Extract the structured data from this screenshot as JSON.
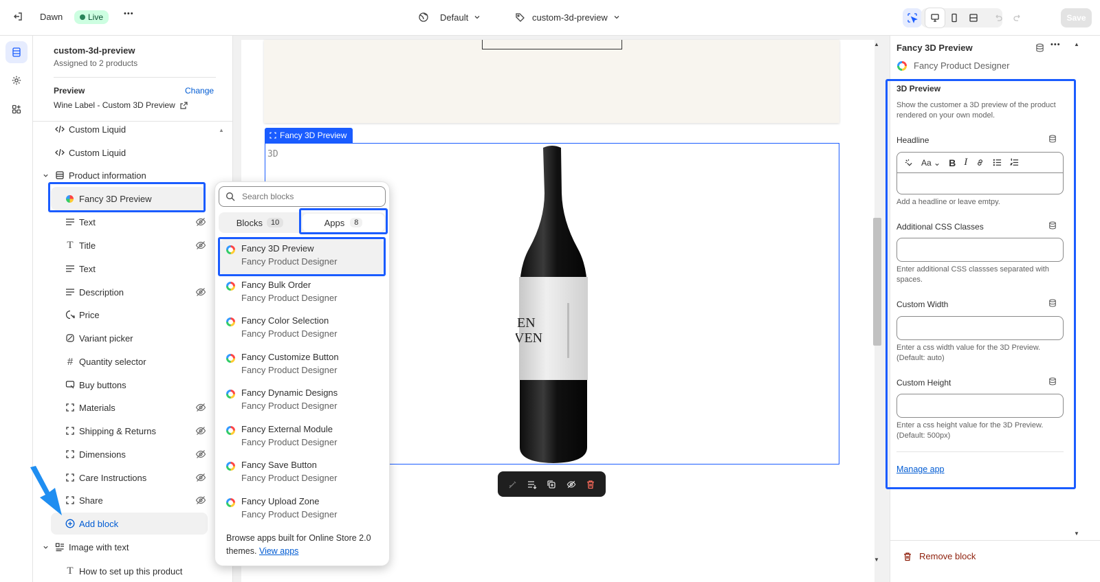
{
  "topbar": {
    "theme_name": "Dawn",
    "status_badge": "Live",
    "more_label": "•••",
    "template_selector": "Default",
    "page_selector": "custom-3d-preview",
    "save_label": "Save"
  },
  "left_panel": {
    "template_title": "custom-3d-preview",
    "template_subtitle": "Assigned to 2 products",
    "preview_label": "Preview",
    "change_label": "Change",
    "preview_value": "Wine Label - Custom 3D Preview",
    "tree": [
      {
        "label": "Custom Liquid",
        "icon": "code-icon"
      },
      {
        "label": "Custom Liquid",
        "icon": "code-icon"
      },
      {
        "label": "Product information",
        "icon": "section-icon"
      },
      {
        "label": "Fancy 3D Preview",
        "icon": "app-logo-icon"
      },
      {
        "label": "Text",
        "icon": "text-icon"
      },
      {
        "label": "Title",
        "icon": "title-icon"
      },
      {
        "label": "Text",
        "icon": "text-icon"
      },
      {
        "label": "Description",
        "icon": "text-icon"
      },
      {
        "label": "Price",
        "icon": "price-tag-icon"
      },
      {
        "label": "Variant picker",
        "icon": "variant-icon"
      },
      {
        "label": "Quantity selector",
        "icon": "hash-icon"
      },
      {
        "label": "Buy buttons",
        "icon": "cart-icon"
      },
      {
        "label": "Materials",
        "icon": "block-icon"
      },
      {
        "label": "Shipping & Returns",
        "icon": "block-icon"
      },
      {
        "label": "Dimensions",
        "icon": "block-icon"
      },
      {
        "label": "Care Instructions",
        "icon": "block-icon"
      },
      {
        "label": "Share",
        "icon": "block-icon"
      },
      {
        "label": "Add block",
        "icon": "plus-circle-icon"
      },
      {
        "label": "Image with text",
        "icon": "image-text-icon"
      },
      {
        "label": "How to set up this product",
        "icon": "title-icon"
      }
    ]
  },
  "popover": {
    "search_placeholder": "Search blocks",
    "tab_blocks": "Blocks",
    "tab_blocks_count": "10",
    "tab_apps": "Apps",
    "tab_apps_count": "8",
    "apps": [
      {
        "title": "Fancy 3D Preview",
        "vendor": "Fancy Product Designer"
      },
      {
        "title": "Fancy Bulk Order",
        "vendor": "Fancy Product Designer"
      },
      {
        "title": "Fancy Color Selection",
        "vendor": "Fancy Product Designer"
      },
      {
        "title": "Fancy Customize Button",
        "vendor": "Fancy Product Designer"
      },
      {
        "title": "Fancy Dynamic Designs",
        "vendor": "Fancy Product Designer"
      },
      {
        "title": "Fancy External Module",
        "vendor": "Fancy Product Designer"
      },
      {
        "title": "Fancy Save Button",
        "vendor": "Fancy Product Designer"
      },
      {
        "title": "Fancy Upload Zone",
        "vendor": "Fancy Product Designer"
      }
    ],
    "footer_text": "Browse apps built for Online Store 2.0 themes.",
    "footer_link": "View apps"
  },
  "canvas": {
    "block_tag": "Fancy 3D Preview",
    "preview_text": "3D",
    "label_text_1": "EN",
    "label_text_2": "VEN"
  },
  "right_panel": {
    "block_title": "Fancy 3D Preview",
    "app_name": "Fancy Product Designer",
    "section_title": "3D Preview",
    "section_desc": "Show the customer a 3D preview of the product rendered on your own model.",
    "headline_label": "Headline",
    "headline_help": "Add a headline or leave emtpy.",
    "css_label": "Additional CSS Classes",
    "css_help": "Enter additional CSS classses separated with spaces.",
    "width_label": "Custom Width",
    "width_help": "Enter a css width value for the 3D Preview. (Default: auto)",
    "height_label": "Custom Height",
    "height_help": "Enter a css height value for the 3D Preview. (Default: 500px)",
    "manage_link": "Manage app",
    "remove_label": "Remove block"
  },
  "colors": {
    "highlight": "#1a5cff",
    "link": "#005bd3",
    "danger": "#8e1f0b",
    "live_bg": "#cdfee1"
  }
}
